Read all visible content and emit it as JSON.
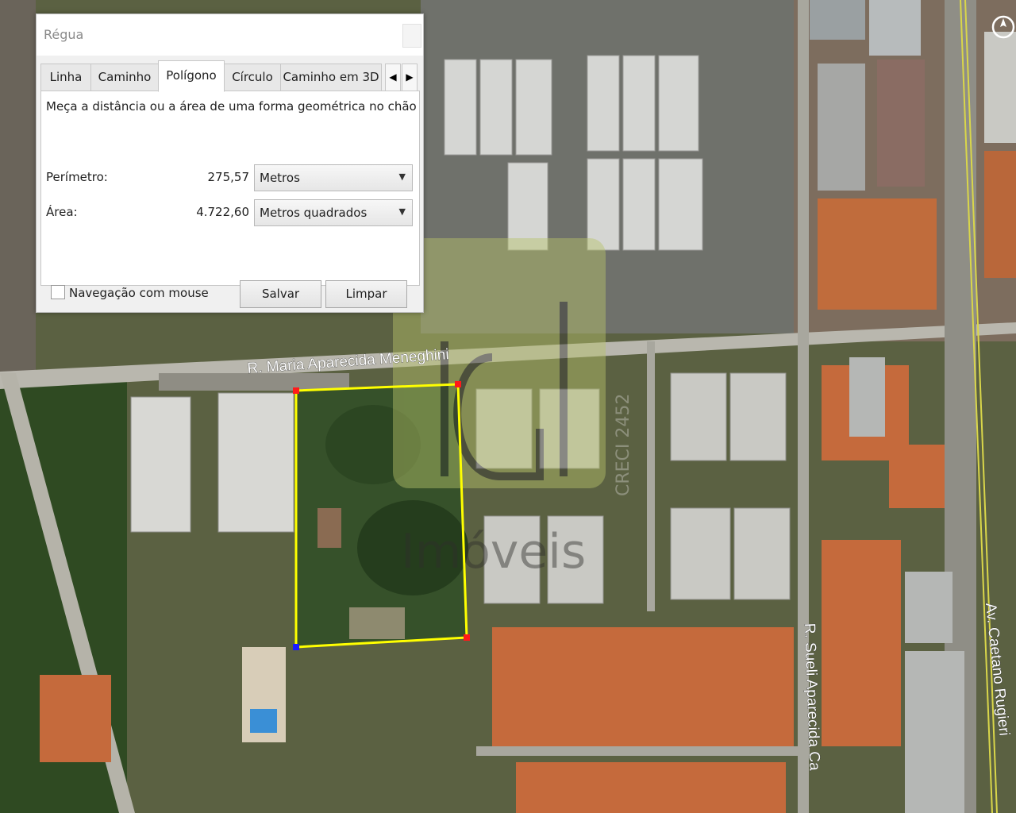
{
  "dialog": {
    "title": "Régua",
    "tabs": [
      {
        "label": "Linha"
      },
      {
        "label": "Caminho"
      },
      {
        "label": "Polígono"
      },
      {
        "label": "Círculo"
      },
      {
        "label": "Caminho em 3D"
      }
    ],
    "active_tab": "Polígono",
    "description": "Meça a distância ou a área de uma forma geométrica no chão",
    "perimeter": {
      "label": "Perímetro:",
      "value": "275,57",
      "unit": "Metros"
    },
    "area": {
      "label": "Área:",
      "value": "4.722,60",
      "unit": "Metros quadrados"
    },
    "mouse_navigation": {
      "label": "Navegação com mouse",
      "checked": false
    },
    "save_label": "Salvar",
    "clear_label": "Limpar"
  },
  "map": {
    "streets": [
      {
        "name": "R. Maria Aparecida Meneghini"
      },
      {
        "name": "R. Sueli Aparecida Ca"
      },
      {
        "name": "Av. Caetano Rugieri"
      }
    ],
    "watermark": {
      "text": "Imóveis",
      "creci": "CRECI 2452"
    },
    "polygon_color": "#ffff00"
  }
}
